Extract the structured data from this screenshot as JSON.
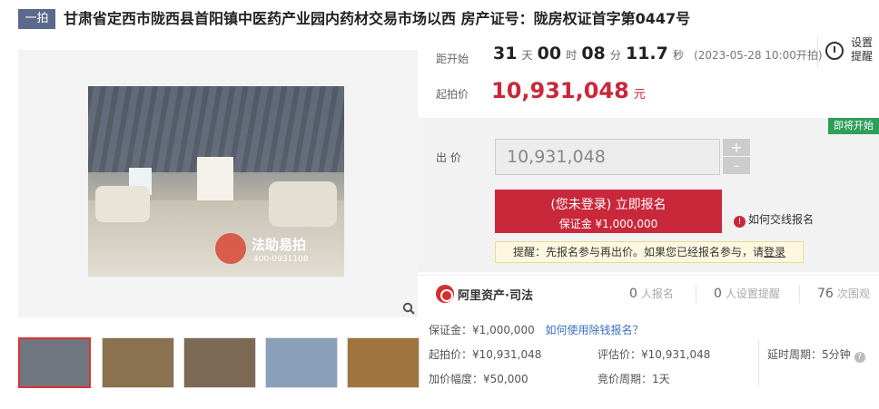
{
  "header": {
    "badge": "一拍",
    "title": "甘肃省定西市陇西县首阳镇中医药产业园内药材交易市场以西 房产证号：陇房权证首字第0447号"
  },
  "gallery": {
    "watermark_text": "法助易拍",
    "watermark_phone": "400-0931108",
    "zoom_icon": "search-icon",
    "thumbnails": [
      {
        "color": "#6f7680"
      },
      {
        "color": "#8a7150"
      },
      {
        "color": "#7d6a55"
      },
      {
        "color": "#8aa0b8"
      },
      {
        "color": "#a0743f"
      }
    ]
  },
  "countdown": {
    "label": "距开始",
    "days": "31",
    "days_unit": "天",
    "hours": "00",
    "hours_unit": "时",
    "minutes": "08",
    "minutes_unit": "分",
    "seconds": "11.7",
    "seconds_unit": "秒",
    "start_note": "(2023-05-28 10:00开拍)"
  },
  "settings": {
    "label": "设置提醒",
    "icon": "alarm-clock-icon"
  },
  "start_price": {
    "label": "起拍价",
    "value": "10,931,048",
    "unit": "元"
  },
  "status_badge": "即将开始",
  "bid": {
    "label": "出 价",
    "value": "10,931,048",
    "plus": "+",
    "minus": "-"
  },
  "register": {
    "line1": "(您未登录) 立即报名",
    "line2": "保证金 ¥1,000,000"
  },
  "how_to_pay": "如何交线报名",
  "hint": {
    "text": "提醒：先报名参与再出价。如果您已经报名参与，请",
    "link": "登录"
  },
  "platform": {
    "name": "阿里资产·司法",
    "stats": [
      {
        "count": "0",
        "label": "人报名"
      },
      {
        "count": "0",
        "label": "人设置提醒"
      },
      {
        "count": "76",
        "label": "次围观"
      }
    ]
  },
  "details": {
    "deposit": "保证金：¥1,000,000",
    "deposit_link": "如何使用除钱报名？",
    "start_price": "起拍价：¥10,931,048",
    "appraisal": "评估价：¥10,931,048",
    "delay": "延时周期：5分钟",
    "increment": "加价幅度：¥50,000",
    "cycle": "竞价周期：1天"
  },
  "colors": {
    "accent": "#c9283a",
    "badge": "#5b6a8a",
    "status_green": "#2f9e59",
    "link": "#3a6fc4"
  }
}
